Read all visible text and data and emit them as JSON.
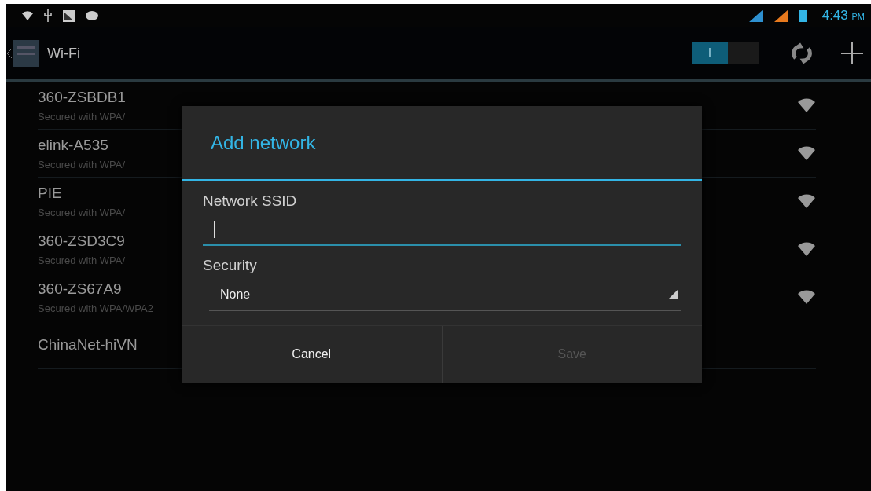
{
  "status_bar": {
    "time": "4:43",
    "meridiem": "PM"
  },
  "action_bar": {
    "title": "Wi-Fi",
    "wifi_switch": {
      "label": "I",
      "on": true
    }
  },
  "networks": [
    {
      "name": "360-ZSBDB1",
      "security": "Secured with WPA/"
    },
    {
      "name": "elink-A535",
      "security": "Secured with WPA/"
    },
    {
      "name": "PIE",
      "security": "Secured with WPA/"
    },
    {
      "name": "360-ZSD3C9",
      "security": "Secured with WPA/"
    },
    {
      "name": "360-ZS67A9",
      "security": "Secured with WPA/WPA2"
    },
    {
      "name": "ChinaNet-hiVN"
    }
  ],
  "dialog": {
    "title": "Add network",
    "ssid_label": "Network SSID",
    "ssid_focused": true,
    "security_label": "Security",
    "security_value": "None",
    "buttons": [
      {
        "label": "Cancel",
        "disabled": false
      },
      {
        "label": "Save",
        "disabled": true
      }
    ]
  }
}
